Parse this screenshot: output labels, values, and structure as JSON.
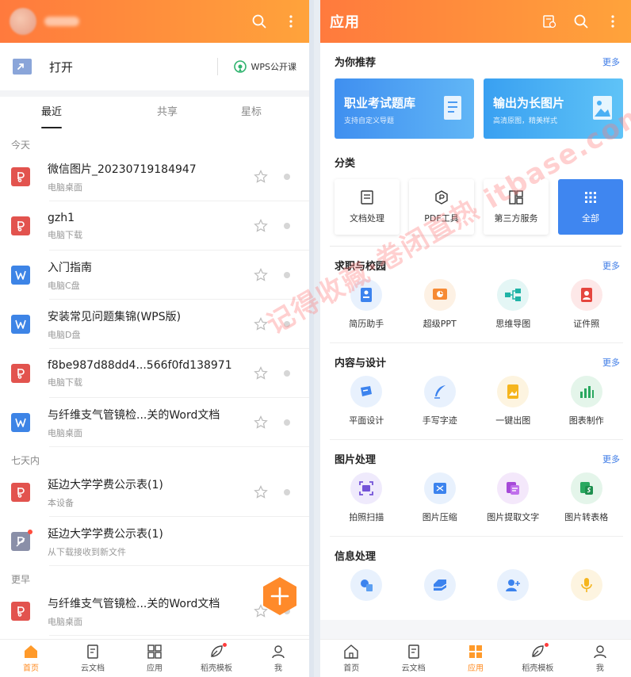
{
  "left": {
    "open_label": "打开",
    "wps_course_label": "WPS公开课",
    "tabs": [
      {
        "label": "最近"
      },
      {
        "label": "共享"
      },
      {
        "label": "星标"
      }
    ],
    "sections": [
      {
        "label": "今天"
      },
      {
        "label": "七天内"
      },
      {
        "label": "更早"
      }
    ],
    "files": [
      {
        "name": "微信图片_20230719184947",
        "location": "电脑桌面"
      },
      {
        "name": "gzh1",
        "location": "电脑下载"
      },
      {
        "name": "入门指南",
        "location": "电脑C盘"
      },
      {
        "name": "安装常见问题集锦(WPS版)",
        "location": "电脑D盘"
      },
      {
        "name": "f8be987d88dd4...566f0fd138971",
        "location": "电脑下载"
      },
      {
        "name": "与纤维支气管镜检...关的Word文档",
        "location": "电脑桌面"
      },
      {
        "name": "延边大学学费公示表(1)",
        "location": "本设备"
      },
      {
        "name": "延边大学学费公示表(1)",
        "location": "从下载接收到新文件"
      },
      {
        "name": "与纤维支气管镜检...关的Word文档",
        "location": "电脑桌面"
      }
    ],
    "bottom_nav": [
      {
        "label": "首页"
      },
      {
        "label": "云文档"
      },
      {
        "label": "应用"
      },
      {
        "label": "稻壳模板"
      },
      {
        "label": "我"
      }
    ]
  },
  "right": {
    "title": "应用",
    "recommend": {
      "title": "为你推荐",
      "more": "更多",
      "cards": [
        {
          "title": "职业考试题库",
          "subtitle": "支持自定义导题"
        },
        {
          "title": "输出为长图片",
          "subtitle": "高清原图，精美样式"
        }
      ]
    },
    "category": {
      "title": "分类",
      "items": [
        {
          "label": "文档处理"
        },
        {
          "label": "PDF工具"
        },
        {
          "label": "第三方服务"
        },
        {
          "label": "全部"
        }
      ]
    },
    "job": {
      "title": "求职与校园",
      "more": "更多",
      "apps": [
        {
          "label": "简历助手"
        },
        {
          "label": "超级PPT"
        },
        {
          "label": "思维导图"
        },
        {
          "label": "证件照"
        }
      ]
    },
    "design": {
      "title": "内容与设计",
      "more": "更多",
      "apps": [
        {
          "label": "平面设计"
        },
        {
          "label": "手写字迹"
        },
        {
          "label": "一键出图"
        },
        {
          "label": "图表制作"
        }
      ]
    },
    "image": {
      "title": "图片处理",
      "more": "更多",
      "apps": [
        {
          "label": "拍照扫描"
        },
        {
          "label": "图片压缩"
        },
        {
          "label": "图片提取文字"
        },
        {
          "label": "图片转表格"
        }
      ]
    },
    "info": {
      "title": "信息处理"
    },
    "bottom_nav": [
      {
        "label": "首页"
      },
      {
        "label": "云文档"
      },
      {
        "label": "应用"
      },
      {
        "label": "稻壳模板"
      },
      {
        "label": "我"
      }
    ]
  },
  "watermark": "记得收藏·卷闭直热  itbase.com",
  "colors": {
    "header_start": "#ff7a3d",
    "header_end": "#ffa33b",
    "accent_orange": "#ff8a1f",
    "blue_primary": "#3f86f0",
    "pdf_red": "#e2534e",
    "word_blue": "#3d84e6"
  }
}
